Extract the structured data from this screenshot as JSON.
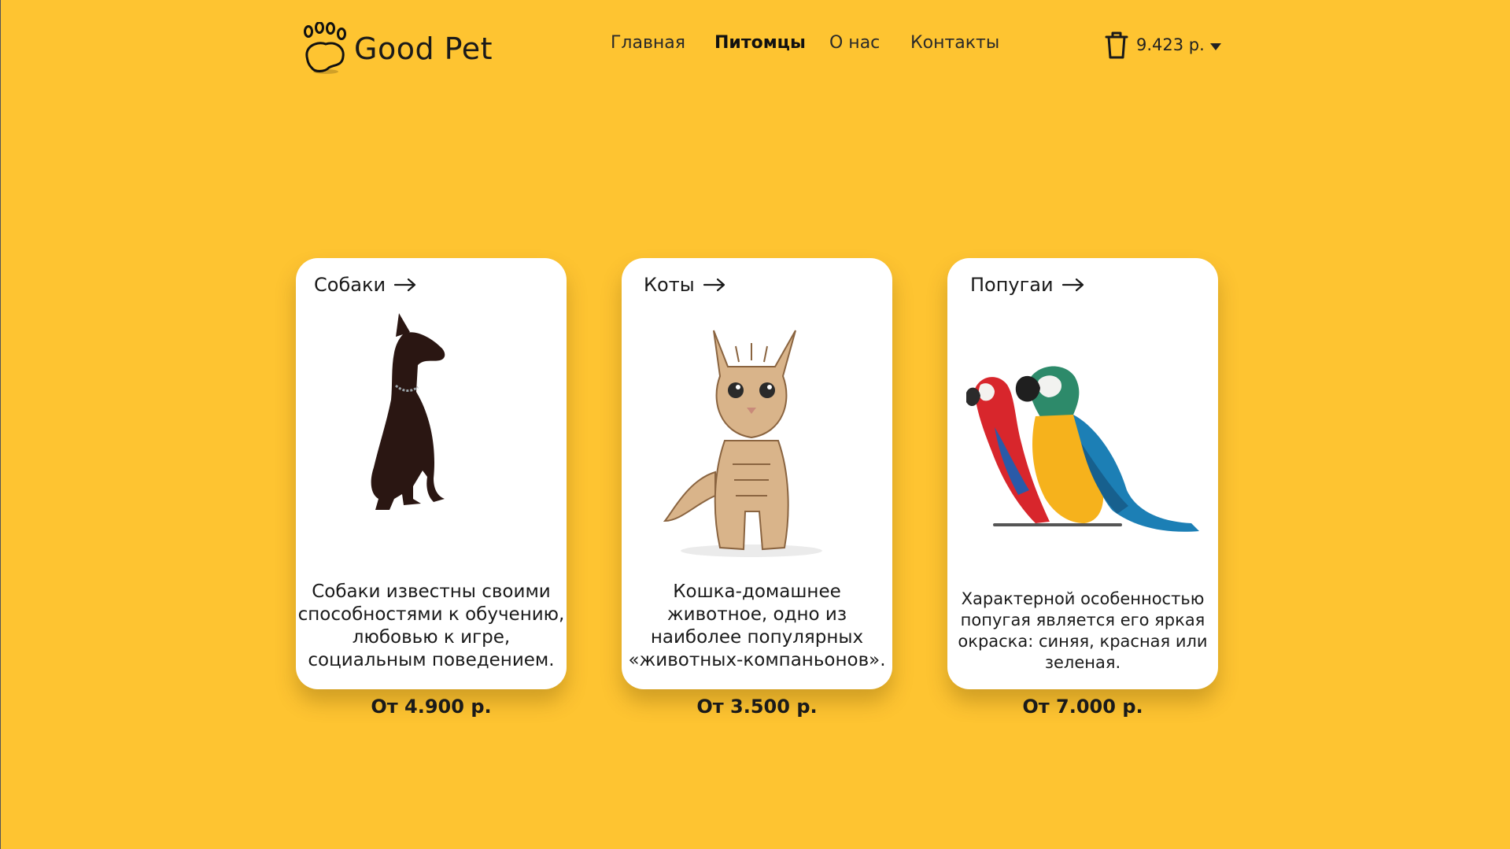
{
  "header": {
    "brand": "Good Pet",
    "nav": [
      {
        "label": "Главная",
        "active": false
      },
      {
        "label": "Питомцы",
        "active": true
      },
      {
        "label": "О нас",
        "active": false
      },
      {
        "label": "Контакты",
        "active": false
      }
    ],
    "cart": {
      "total": "9.423 р.",
      "icon": "trash-bag-icon"
    }
  },
  "cards": [
    {
      "title": "Собаки",
      "description": "Собаки известны своими способностями к обучению, любовью к игре, социальным поведением.",
      "price": "От 4.900 р.",
      "image": "doberman-dog"
    },
    {
      "title": "Коты",
      "description": "Кошка-домашнее животное, одно из наиболее популярных «животных-компаньонов».",
      "price": "От 3.500 р.",
      "image": "tabby-kitten"
    },
    {
      "title": "Попугаи",
      "description": "Характерной особенностью попугая является его яркая окраска: синяя, красная или зеленая.",
      "price": "От 7.000 р.",
      "image": "macaw-parrots"
    }
  ],
  "colors": {
    "background": "#FEC431",
    "card": "#FFFFFF",
    "text": "#1A1A1A"
  }
}
